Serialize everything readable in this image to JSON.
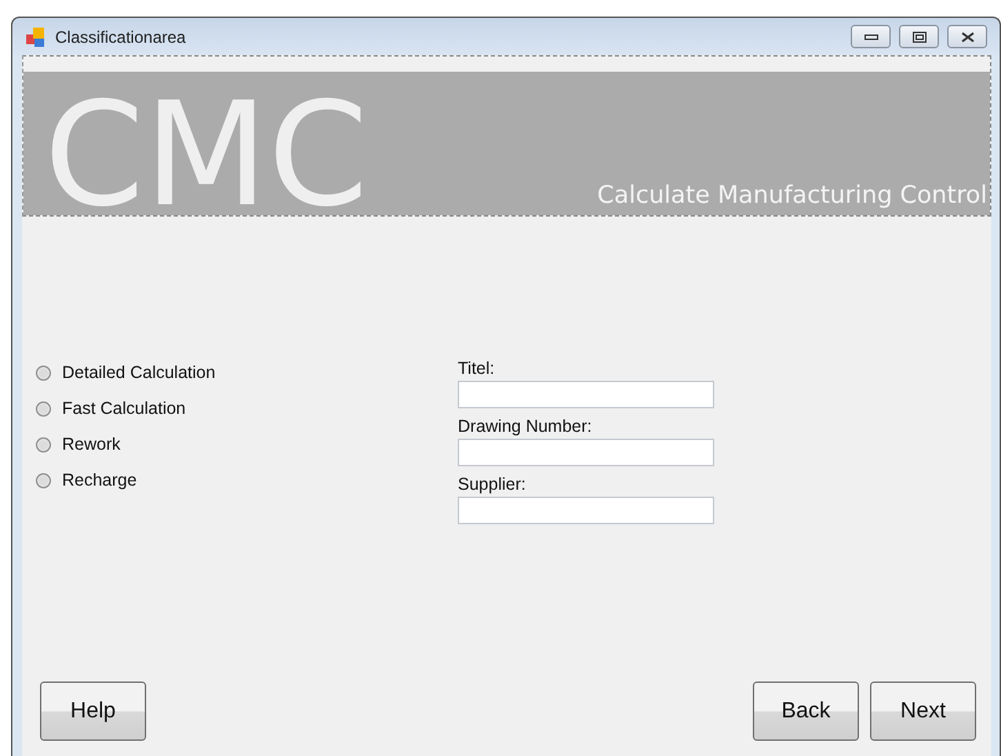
{
  "window": {
    "title": "Classificationarea"
  },
  "banner": {
    "logo": "CMC",
    "subtitle": "Calculate Manufacturing Control"
  },
  "options": [
    {
      "label": "Detailed Calculation",
      "selected": false
    },
    {
      "label": "Fast Calculation",
      "selected": false
    },
    {
      "label": "Rework",
      "selected": false
    },
    {
      "label": "Recharge",
      "selected": false
    }
  ],
  "fields": [
    {
      "label": "Titel:"
    },
    {
      "label": "Drawing Number:"
    },
    {
      "label": "Supplier:"
    }
  ],
  "buttons_left": [
    "Help"
  ],
  "buttons_right": [
    "Back",
    "Next"
  ]
}
